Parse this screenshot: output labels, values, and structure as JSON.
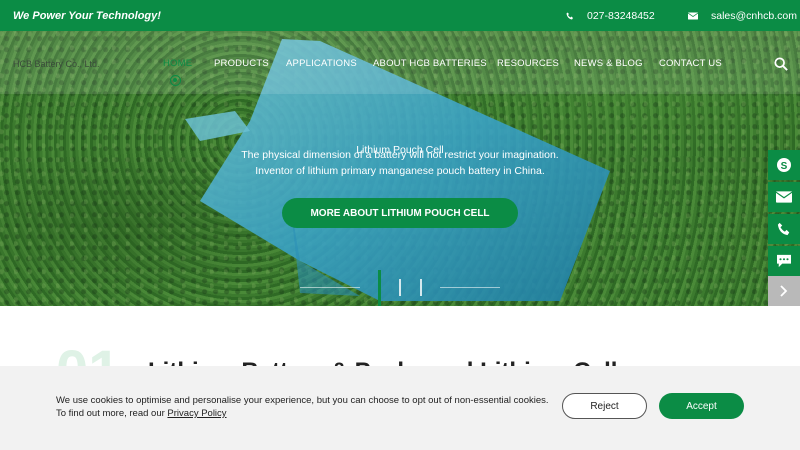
{
  "topbar": {
    "tagline": "We Power Your Technology!",
    "phone": "027-83248452",
    "email": "sales@cnhcb.com"
  },
  "nav": {
    "company": "HCB Battery Co., Ltd.",
    "items": [
      "HOME",
      "PRODUCTS",
      "APPLICATIONS",
      "ABOUT HCB BATTERIES",
      "RESOURCES",
      "NEWS & BLOG",
      "CONTACT US"
    ],
    "active_index": 0
  },
  "hero": {
    "title": "Lithium Pouch Cell",
    "line1": "The physical dimension of a battery will not restrict your imagination.",
    "line2": "Inventor of lithium primary manganese pouch battery in China.",
    "cta": "MORE ABOUT LITHIUM POUCH CELL",
    "slide_count": 3,
    "active_slide": 1
  },
  "section": {
    "number": "01",
    "title": "Lithium Battery & Packs and Lithium Cells"
  },
  "cookie": {
    "text_line1": "We use cookies to optimise and personalise your experience, but you can choose to opt out of non-essential cookies.",
    "text_line2_prefix": "To find out more, read our ",
    "privacy_link": "Privacy Policy",
    "reject": "Reject",
    "accept": "Accept"
  },
  "colors": {
    "brand_green": "#0b8c45",
    "cookie_bg": "#f2f2f2"
  },
  "side_buttons": [
    "skype-icon",
    "mail-icon",
    "phone-icon",
    "chat-icon",
    "chevron-right-icon"
  ]
}
